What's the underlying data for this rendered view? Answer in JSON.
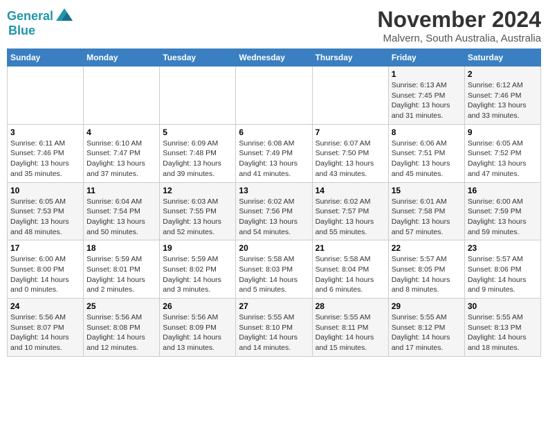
{
  "header": {
    "logo_line1": "General",
    "logo_line2": "Blue",
    "month": "November 2024",
    "location": "Malvern, South Australia, Australia"
  },
  "weekdays": [
    "Sunday",
    "Monday",
    "Tuesday",
    "Wednesday",
    "Thursday",
    "Friday",
    "Saturday"
  ],
  "weeks": [
    [
      {
        "day": "",
        "info": ""
      },
      {
        "day": "",
        "info": ""
      },
      {
        "day": "",
        "info": ""
      },
      {
        "day": "",
        "info": ""
      },
      {
        "day": "",
        "info": ""
      },
      {
        "day": "1",
        "info": "Sunrise: 6:13 AM\nSunset: 7:45 PM\nDaylight: 13 hours\nand 31 minutes."
      },
      {
        "day": "2",
        "info": "Sunrise: 6:12 AM\nSunset: 7:46 PM\nDaylight: 13 hours\nand 33 minutes."
      }
    ],
    [
      {
        "day": "3",
        "info": "Sunrise: 6:11 AM\nSunset: 7:46 PM\nDaylight: 13 hours\nand 35 minutes."
      },
      {
        "day": "4",
        "info": "Sunrise: 6:10 AM\nSunset: 7:47 PM\nDaylight: 13 hours\nand 37 minutes."
      },
      {
        "day": "5",
        "info": "Sunrise: 6:09 AM\nSunset: 7:48 PM\nDaylight: 13 hours\nand 39 minutes."
      },
      {
        "day": "6",
        "info": "Sunrise: 6:08 AM\nSunset: 7:49 PM\nDaylight: 13 hours\nand 41 minutes."
      },
      {
        "day": "7",
        "info": "Sunrise: 6:07 AM\nSunset: 7:50 PM\nDaylight: 13 hours\nand 43 minutes."
      },
      {
        "day": "8",
        "info": "Sunrise: 6:06 AM\nSunset: 7:51 PM\nDaylight: 13 hours\nand 45 minutes."
      },
      {
        "day": "9",
        "info": "Sunrise: 6:05 AM\nSunset: 7:52 PM\nDaylight: 13 hours\nand 47 minutes."
      }
    ],
    [
      {
        "day": "10",
        "info": "Sunrise: 6:05 AM\nSunset: 7:53 PM\nDaylight: 13 hours\nand 48 minutes."
      },
      {
        "day": "11",
        "info": "Sunrise: 6:04 AM\nSunset: 7:54 PM\nDaylight: 13 hours\nand 50 minutes."
      },
      {
        "day": "12",
        "info": "Sunrise: 6:03 AM\nSunset: 7:55 PM\nDaylight: 13 hours\nand 52 minutes."
      },
      {
        "day": "13",
        "info": "Sunrise: 6:02 AM\nSunset: 7:56 PM\nDaylight: 13 hours\nand 54 minutes."
      },
      {
        "day": "14",
        "info": "Sunrise: 6:02 AM\nSunset: 7:57 PM\nDaylight: 13 hours\nand 55 minutes."
      },
      {
        "day": "15",
        "info": "Sunrise: 6:01 AM\nSunset: 7:58 PM\nDaylight: 13 hours\nand 57 minutes."
      },
      {
        "day": "16",
        "info": "Sunrise: 6:00 AM\nSunset: 7:59 PM\nDaylight: 13 hours\nand 59 minutes."
      }
    ],
    [
      {
        "day": "17",
        "info": "Sunrise: 6:00 AM\nSunset: 8:00 PM\nDaylight: 14 hours\nand 0 minutes."
      },
      {
        "day": "18",
        "info": "Sunrise: 5:59 AM\nSunset: 8:01 PM\nDaylight: 14 hours\nand 2 minutes."
      },
      {
        "day": "19",
        "info": "Sunrise: 5:59 AM\nSunset: 8:02 PM\nDaylight: 14 hours\nand 3 minutes."
      },
      {
        "day": "20",
        "info": "Sunrise: 5:58 AM\nSunset: 8:03 PM\nDaylight: 14 hours\nand 5 minutes."
      },
      {
        "day": "21",
        "info": "Sunrise: 5:58 AM\nSunset: 8:04 PM\nDaylight: 14 hours\nand 6 minutes."
      },
      {
        "day": "22",
        "info": "Sunrise: 5:57 AM\nSunset: 8:05 PM\nDaylight: 14 hours\nand 8 minutes."
      },
      {
        "day": "23",
        "info": "Sunrise: 5:57 AM\nSunset: 8:06 PM\nDaylight: 14 hours\nand 9 minutes."
      }
    ],
    [
      {
        "day": "24",
        "info": "Sunrise: 5:56 AM\nSunset: 8:07 PM\nDaylight: 14 hours\nand 10 minutes."
      },
      {
        "day": "25",
        "info": "Sunrise: 5:56 AM\nSunset: 8:08 PM\nDaylight: 14 hours\nand 12 minutes."
      },
      {
        "day": "26",
        "info": "Sunrise: 5:56 AM\nSunset: 8:09 PM\nDaylight: 14 hours\nand 13 minutes."
      },
      {
        "day": "27",
        "info": "Sunrise: 5:55 AM\nSunset: 8:10 PM\nDaylight: 14 hours\nand 14 minutes."
      },
      {
        "day": "28",
        "info": "Sunrise: 5:55 AM\nSunset: 8:11 PM\nDaylight: 14 hours\nand 15 minutes."
      },
      {
        "day": "29",
        "info": "Sunrise: 5:55 AM\nSunset: 8:12 PM\nDaylight: 14 hours\nand 17 minutes."
      },
      {
        "day": "30",
        "info": "Sunrise: 5:55 AM\nSunset: 8:13 PM\nDaylight: 14 hours\nand 18 minutes."
      }
    ]
  ]
}
